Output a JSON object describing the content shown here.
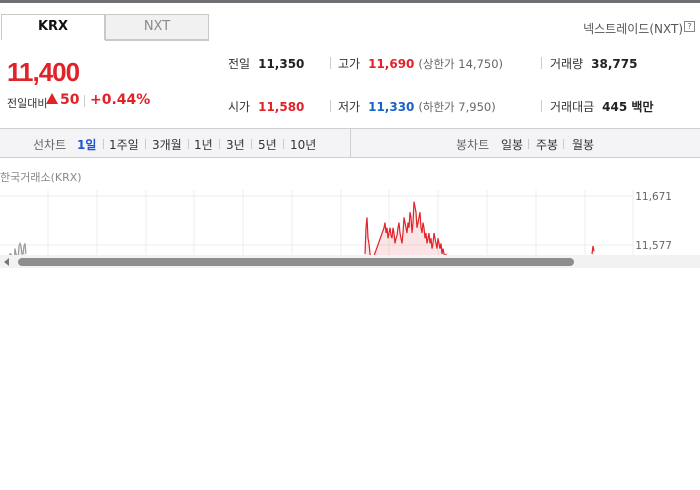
{
  "tabs": {
    "krx": "KRX",
    "nxt": "NXT"
  },
  "nxt_link": "넥스트레이드(NXT)",
  "help_icon_glyph": "?",
  "price": {
    "current": "11,400",
    "change_label": "전일대비",
    "change_value": "50",
    "change_pct": "+0.44%",
    "color_up": "#e12228",
    "color_down": "#1a62c4"
  },
  "stats": {
    "prev_close": {
      "label": "전일",
      "value": "11,350"
    },
    "high": {
      "label": "고가",
      "value": "11,690",
      "sub": "(상한가 14,750)"
    },
    "volume": {
      "label": "거래량",
      "value": "38,775"
    },
    "open": {
      "label": "시가",
      "value": "11,580"
    },
    "low": {
      "label": "저가",
      "value": "11,330",
      "sub": "(하한가 7,950)"
    },
    "amount": {
      "label": "거래대금",
      "value": "445 백만"
    }
  },
  "period_bar": {
    "line_label": "선차트",
    "line_items": [
      "1일",
      "1주일",
      "3개월",
      "1년",
      "3년",
      "5년",
      "10년"
    ],
    "active": "1일",
    "candle_label": "봉차트",
    "candle_items": [
      "일봉",
      "주봉",
      "월봉"
    ]
  },
  "chart": {
    "source_label": "한국거래소(KRX)",
    "y_ticks": [
      "11,671",
      "11,577"
    ]
  },
  "chart_data": {
    "type": "line",
    "title": "",
    "xlabel": "",
    "ylabel": "",
    "y_ticks": [
      11671,
      11577
    ],
    "ylim": [
      11483,
      11671
    ],
    "grid": true,
    "series": [
      {
        "x": [
          0,
          2,
          3,
          4,
          6,
          7,
          8,
          10,
          11,
          12,
          13,
          14,
          15,
          16,
          17,
          18
        ],
        "values": [
          11530,
          11560,
          11560,
          11540,
          11540,
          11570,
          11560,
          11550,
          11575,
          11580,
          11575,
          11560,
          11560,
          11575,
          11580,
          11560
        ]
      },
      {
        "x": [
          357,
          358,
          359,
          360,
          361,
          362,
          363,
          376,
          377,
          378,
          379,
          380,
          381,
          382,
          383,
          384,
          385,
          386,
          387,
          388,
          389,
          390,
          391,
          392,
          393,
          394,
          395,
          396,
          397,
          398,
          399,
          400,
          401,
          402,
          403,
          404,
          405,
          406,
          407,
          408,
          409,
          410,
          411,
          412,
          413,
          414,
          415,
          416,
          417,
          418,
          419,
          420,
          421,
          422,
          423,
          424,
          425,
          426,
          427,
          428,
          429,
          430,
          431,
          432,
          433,
          434,
          435,
          436,
          437,
          438,
          439,
          440,
          441,
          442
        ],
        "values": [
          11560,
          11610,
          11630,
          11590,
          11580,
          11560,
          11540,
          11610,
          11620,
          11600,
          11610,
          11590,
          11600,
          11610,
          11595,
          11590,
          11610,
          11600,
          11580,
          11590,
          11595,
          11610,
          11620,
          11600,
          11590,
          11580,
          11600,
          11630,
          11620,
          11610,
          11600,
          11620,
          11610,
          11640,
          11630,
          11600,
          11620,
          11660,
          11650,
          11640,
          11610,
          11620,
          11630,
          11640,
          11610,
          11600,
          11620,
          11610,
          11590,
          11600,
          11580,
          11590,
          11600,
          11580,
          11590,
          11570,
          11580,
          11600,
          11590,
          11580,
          11570,
          11590,
          11580,
          11570,
          11580,
          11560,
          11570,
          11560,
          11550,
          11560,
          11540,
          11550,
          11530,
          11520
        ]
      },
      {
        "x": [
          584,
          585,
          586
        ],
        "values": [
          11560,
          11575,
          11565
        ]
      }
    ]
  }
}
